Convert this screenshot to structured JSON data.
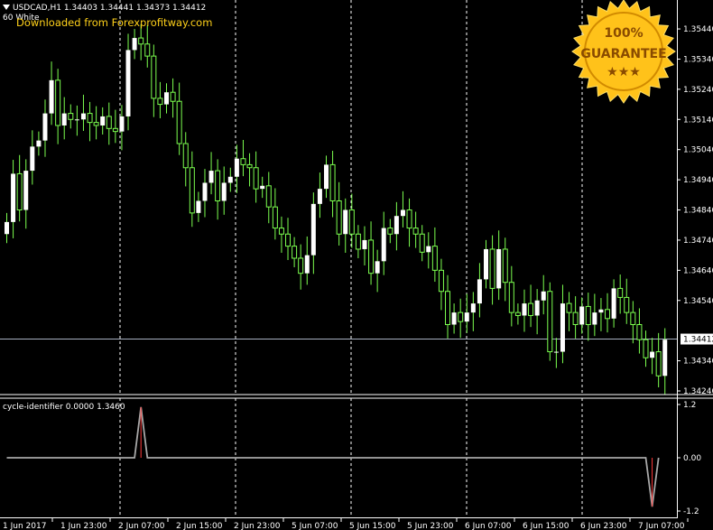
{
  "chart_data": [
    {
      "type": "candlestick",
      "title": "USDCAD,H1  1.34403 1.34441 1.34373 1.34412",
      "subtitle": "60 White",
      "watermark": "Downloaded from Forexprofitway.com",
      "ylim": [
        1.3424,
        1.355
      ],
      "y_ticks": [
        "1.35440",
        "1.35340",
        "1.35240",
        "1.35140",
        "1.35040",
        "1.34940",
        "1.34840",
        "1.34740",
        "1.34640",
        "1.34540",
        "1.34340",
        "1.34240"
      ],
      "current_price": "1.34412",
      "current_price_value": 1.34412,
      "x_ticks": [
        "1 Jun 2017",
        "1 Jun 23:00",
        "2 Jun 07:00",
        "2 Jun 15:00",
        "2 Jun 23:00",
        "5 Jun 07:00",
        "5 Jun 15:00",
        "5 Jun 23:00",
        "6 Jun 07:00",
        "6 Jun 15:00",
        "6 Jun 23:00",
        "7 Jun 07:00"
      ],
      "separator_after_ticks": [
        1,
        3,
        5,
        7,
        9
      ],
      "bull_color": "#ffffff",
      "wick_color": "#7cff4f",
      "close": [
        1.348,
        1.3496,
        1.3484,
        1.3497,
        1.3505,
        1.3507,
        1.3516,
        1.3527,
        1.3512,
        1.3516,
        1.3514,
        1.3514,
        1.3516,
        1.3513,
        1.3512,
        1.3515,
        1.3511,
        1.351,
        1.3515,
        1.3537,
        1.3541,
        1.3539,
        1.3535,
        1.3521,
        1.3519,
        1.3523,
        1.352,
        1.3506,
        1.3498,
        1.3483,
        1.3487,
        1.3493,
        1.3497,
        1.3487,
        1.3493,
        1.3495,
        1.3501,
        1.3499,
        1.3498,
        1.3491,
        1.3492,
        1.3485,
        1.3478,
        1.3476,
        1.3472,
        1.3468,
        1.3463,
        1.3469,
        1.3486,
        1.3491,
        1.3499,
        1.3487,
        1.3476,
        1.3484,
        1.3476,
        1.3471,
        1.3474,
        1.3463,
        1.3467,
        1.3478,
        1.3476,
        1.3482,
        1.3484,
        1.3478,
        1.3476,
        1.347,
        1.3472,
        1.3464,
        1.3457,
        1.3446,
        1.345,
        1.3447,
        1.345,
        1.3453,
        1.3461,
        1.3471,
        1.3458,
        1.3471,
        1.346,
        1.345,
        1.3449,
        1.3453,
        1.3449,
        1.3454,
        1.3457,
        1.3437,
        1.3437,
        1.3453,
        1.345,
        1.3446,
        1.3452,
        1.3446,
        1.345,
        1.3451,
        1.3448,
        1.3458,
        1.3455,
        1.345,
        1.3446,
        1.3441,
        1.3435,
        1.3437,
        1.3429,
        1.3441
      ],
      "indicator": {
        "title": "cycle-identifier 0.0000 1.3460",
        "y_ticks": [
          "1.2",
          "0.00",
          "-1.2"
        ],
        "ylim": [
          -1.2,
          1.2
        ],
        "line_color": "#a8a8a8",
        "values": [
          0,
          0,
          0,
          0,
          0,
          0,
          0,
          0,
          0,
          0,
          0,
          0,
          0,
          0,
          0,
          0,
          0,
          0,
          0,
          0,
          0,
          1.14,
          0,
          0,
          0,
          0,
          0,
          0,
          0,
          0,
          0,
          0,
          0,
          0,
          0,
          0,
          0,
          0,
          0,
          0,
          0,
          0,
          0,
          0,
          0,
          0,
          0,
          0,
          0,
          0,
          0,
          0,
          0,
          0,
          0,
          0,
          0,
          0,
          0,
          0,
          0,
          0,
          0,
          0,
          0,
          0,
          0,
          0,
          0,
          0,
          0,
          0,
          0,
          0,
          0,
          0,
          0,
          0,
          0,
          0,
          0,
          0,
          0,
          0,
          0,
          0,
          0,
          0,
          0,
          0,
          0,
          0,
          0,
          0,
          0,
          0,
          0,
          0,
          0,
          0,
          0,
          -1.1,
          0
        ]
      }
    }
  ],
  "badge": {
    "line1": "100%",
    "line2": "GUARANTEE",
    "stars": "★★★",
    "fill": "#ffc21a"
  }
}
